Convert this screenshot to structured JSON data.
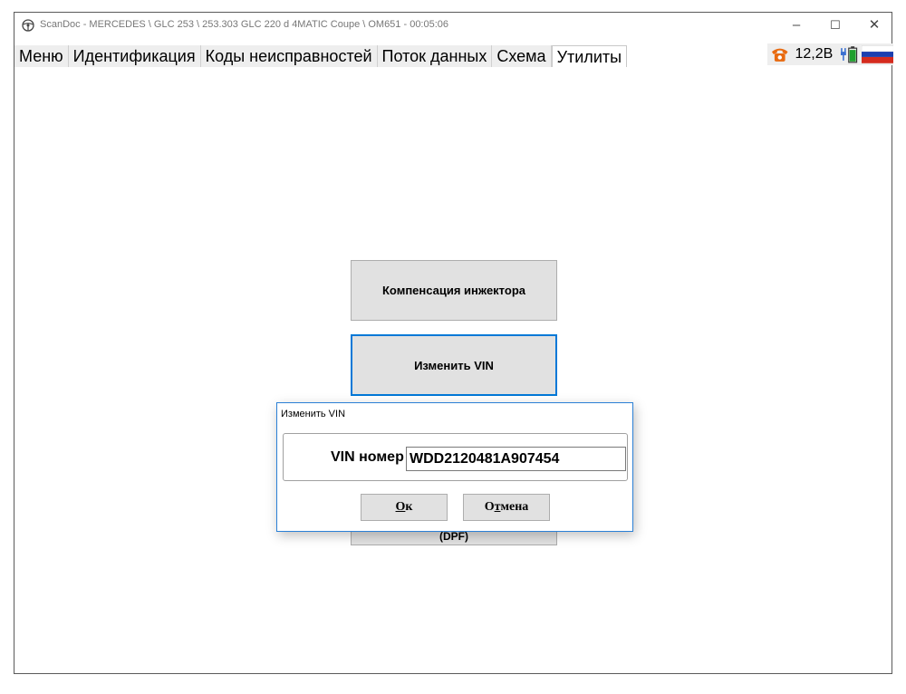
{
  "window": {
    "title": "ScanDoc - MERCEDES \\ GLC 253 \\ 253.303 GLC 220 d 4MATIC Coupe \\ OM651 - 00:05:06",
    "minimize": "–",
    "maximize": "☐",
    "close": "✕"
  },
  "tabs": [
    {
      "label": "Меню"
    },
    {
      "label": "Идентификация"
    },
    {
      "label": "Коды неисправностей"
    },
    {
      "label": "Поток данных"
    },
    {
      "label": "Схема"
    },
    {
      "label": "Утилиты",
      "active": true
    }
  ],
  "status": {
    "voltage": "12,2В",
    "icons": [
      "phone-icon",
      "plug-battery-icon",
      "russia-flag-icon"
    ],
    "colors": {
      "phone": "#e86a10",
      "battery": "#1fa02d"
    }
  },
  "utilities": {
    "injector_compensation": "Компенсация инжектора",
    "change_vin": "Изменить VIN",
    "dpf_partial": "(DPF)"
  },
  "dialog": {
    "title": "Изменить VIN",
    "vin_label": "VIN номер",
    "vin_value": "WDD2120481A907454",
    "ok_mnemonic": "О",
    "ok_rest": "к",
    "cancel_mnemonic": "О",
    "cancel_underlined": "т",
    "cancel_rest": "мена"
  },
  "colors": {
    "accent": "#0078d7",
    "button_bg": "#e1e1e1",
    "tab_bg": "#eeeeee"
  }
}
